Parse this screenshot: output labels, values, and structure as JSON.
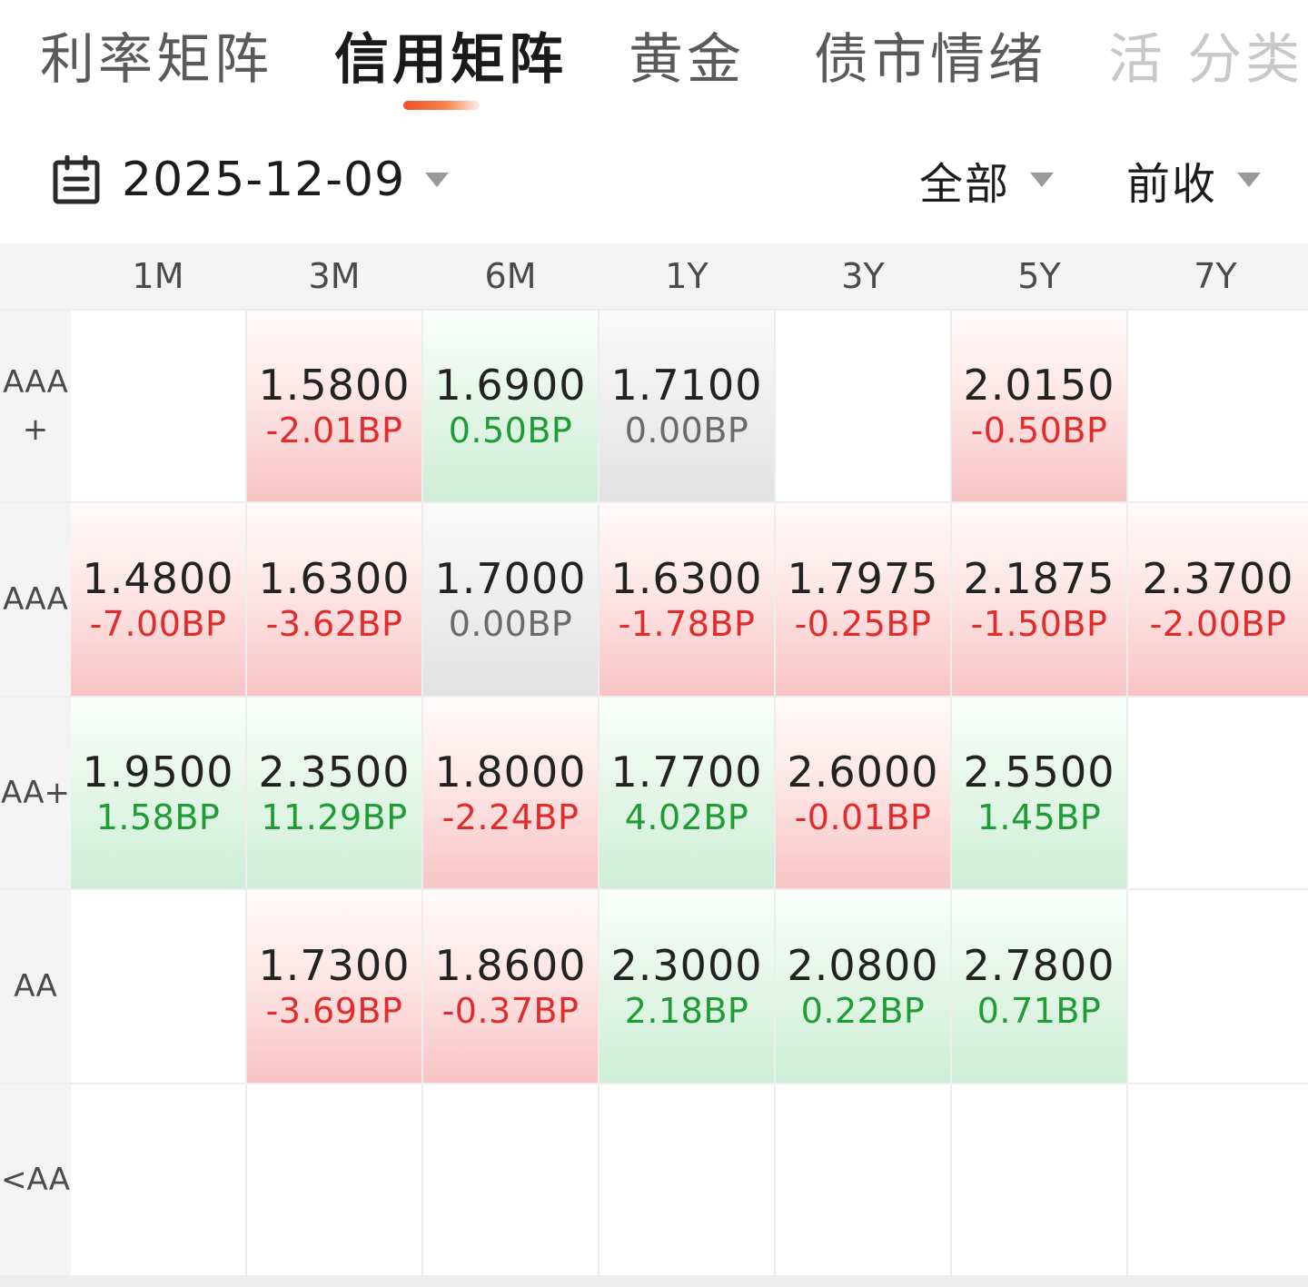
{
  "tabs": [
    {
      "label": "利率矩阵",
      "active": false
    },
    {
      "label": "信用矩阵",
      "active": true
    },
    {
      "label": "黄金",
      "active": false
    },
    {
      "label": "债市情绪",
      "active": false
    },
    {
      "label": "活 分类",
      "active": false
    }
  ],
  "filter": {
    "date": "2025-12-09",
    "scope_label": "全部",
    "price_label": "前收"
  },
  "colors": {
    "accent": "#f0502a",
    "up_text": "#e22b2b",
    "down_text": "#1f9c33",
    "flat_text": "#6a6a6a",
    "up_fill": "#f8c4c4",
    "down_fill": "#cdeed6",
    "flat_fill": "#e2e2e2"
  },
  "icons": {
    "calendar": "calendar-icon",
    "dropdown": "caret-down-icon"
  },
  "matrix": {
    "columns": [
      "1M",
      "3M",
      "6M",
      "1Y",
      "3Y",
      "5Y",
      "7Y"
    ],
    "rows": [
      {
        "label_line1": "AAA",
        "label_line2": "+",
        "cells": [
          null,
          {
            "yield": "1.5800",
            "change": "-2.01BP",
            "trend": "up"
          },
          {
            "yield": "1.6900",
            "change": "0.50BP",
            "trend": "down"
          },
          {
            "yield": "1.7100",
            "change": "0.00BP",
            "trend": "flat"
          },
          null,
          {
            "yield": "2.0150",
            "change": "-0.50BP",
            "trend": "up"
          },
          null
        ]
      },
      {
        "label_line1": "AAA",
        "label_line2": "",
        "cells": [
          {
            "yield": "1.4800",
            "change": "-7.00BP",
            "trend": "up"
          },
          {
            "yield": "1.6300",
            "change": "-3.62BP",
            "trend": "up"
          },
          {
            "yield": "1.7000",
            "change": "0.00BP",
            "trend": "flat"
          },
          {
            "yield": "1.6300",
            "change": "-1.78BP",
            "trend": "up"
          },
          {
            "yield": "1.7975",
            "change": "-0.25BP",
            "trend": "up"
          },
          {
            "yield": "2.1875",
            "change": "-1.50BP",
            "trend": "up"
          },
          {
            "yield": "2.3700",
            "change": "-2.00BP",
            "trend": "up"
          }
        ]
      },
      {
        "label_line1": "AA+",
        "label_line2": "",
        "cells": [
          {
            "yield": "1.9500",
            "change": "1.58BP",
            "trend": "down"
          },
          {
            "yield": "2.3500",
            "change": "11.29BP",
            "trend": "down"
          },
          {
            "yield": "1.8000",
            "change": "-2.24BP",
            "trend": "up"
          },
          {
            "yield": "1.7700",
            "change": "4.02BP",
            "trend": "down"
          },
          {
            "yield": "2.6000",
            "change": "-0.01BP",
            "trend": "up"
          },
          {
            "yield": "2.5500",
            "change": "1.45BP",
            "trend": "down"
          },
          null
        ]
      },
      {
        "label_line1": "AA",
        "label_line2": "",
        "cells": [
          null,
          {
            "yield": "1.7300",
            "change": "-3.69BP",
            "trend": "up"
          },
          {
            "yield": "1.8600",
            "change": "-0.37BP",
            "trend": "up"
          },
          {
            "yield": "2.3000",
            "change": "2.18BP",
            "trend": "down"
          },
          {
            "yield": "2.0800",
            "change": "0.22BP",
            "trend": "down"
          },
          {
            "yield": "2.7800",
            "change": "0.71BP",
            "trend": "down"
          },
          null
        ]
      },
      {
        "label_line1": "<AA",
        "label_line2": "",
        "cells": [
          null,
          null,
          null,
          null,
          null,
          null,
          null
        ]
      }
    ]
  }
}
